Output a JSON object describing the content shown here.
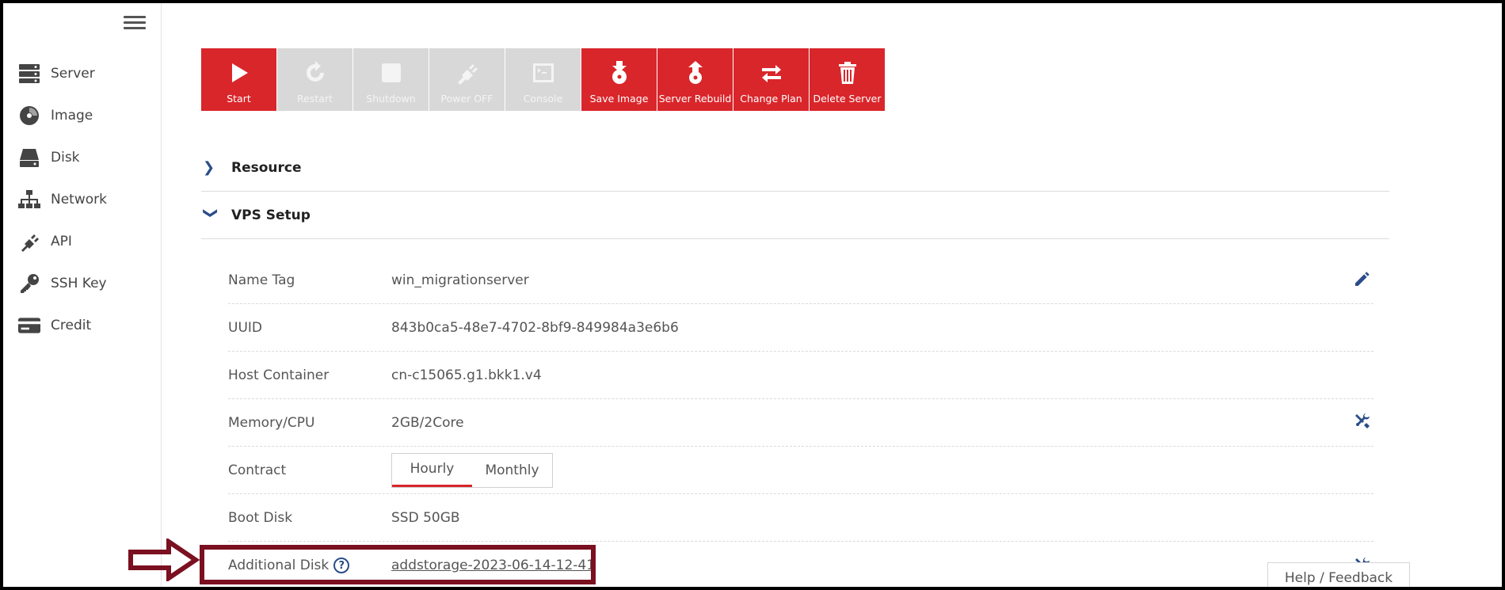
{
  "sidebar": {
    "items": [
      {
        "label": "Server",
        "icon": "server-icon"
      },
      {
        "label": "Image",
        "icon": "image-disc-icon"
      },
      {
        "label": "Disk",
        "icon": "disk-icon"
      },
      {
        "label": "Network",
        "icon": "network-icon"
      },
      {
        "label": "API",
        "icon": "api-plug-icon"
      },
      {
        "label": "SSH Key",
        "icon": "key-icon"
      },
      {
        "label": "Credit",
        "icon": "credit-card-icon"
      }
    ]
  },
  "toolbar": {
    "buttons": [
      {
        "label": "Start",
        "state": "enabled",
        "icon": "play-icon"
      },
      {
        "label": "Restart",
        "state": "disabled",
        "icon": "restart-icon"
      },
      {
        "label": "Shutdown",
        "state": "disabled",
        "icon": "stop-icon"
      },
      {
        "label": "Power OFF",
        "state": "disabled",
        "icon": "power-plug-icon"
      },
      {
        "label": "Console",
        "state": "disabled",
        "icon": "console-icon"
      },
      {
        "label": "Save Image",
        "state": "enabled",
        "icon": "save-image-icon"
      },
      {
        "label": "Server Rebuild",
        "state": "enabled",
        "icon": "rebuild-icon"
      },
      {
        "label": "Change Plan",
        "state": "enabled",
        "icon": "swap-arrows-icon"
      },
      {
        "label": "Delete Server",
        "state": "enabled",
        "icon": "trash-icon"
      }
    ]
  },
  "sections": {
    "resource": {
      "title": "Resource",
      "expanded": false
    },
    "vps_setup": {
      "title": "VPS Setup",
      "expanded": true
    }
  },
  "vps": {
    "name_tag": {
      "label": "Name Tag",
      "value": "win_migrationserver"
    },
    "uuid": {
      "label": "UUID",
      "value": "843b0ca5-48e7-4702-8bf9-849984a3e6b6"
    },
    "host": {
      "label": "Host Container",
      "value": "cn-c15065.g1.bkk1.v4"
    },
    "memcpu": {
      "label": "Memory/CPU",
      "value": "2GB/2Core"
    },
    "contract": {
      "label": "Contract",
      "options": [
        "Hourly",
        "Monthly"
      ],
      "selected": "Hourly"
    },
    "boot_disk": {
      "label": "Boot Disk",
      "value": "SSD 50GB"
    },
    "additional_disk": {
      "label": "Additional Disk",
      "value": "addstorage-2023-06-14-12-41"
    }
  },
  "help": {
    "question_mark": "?"
  },
  "feedback": {
    "label": "Help / Feedback"
  },
  "colors": {
    "accent": "#d9262b",
    "disabled": "#d8d8d8",
    "link": "#2a4c8a",
    "highlight": "#7a1020"
  }
}
